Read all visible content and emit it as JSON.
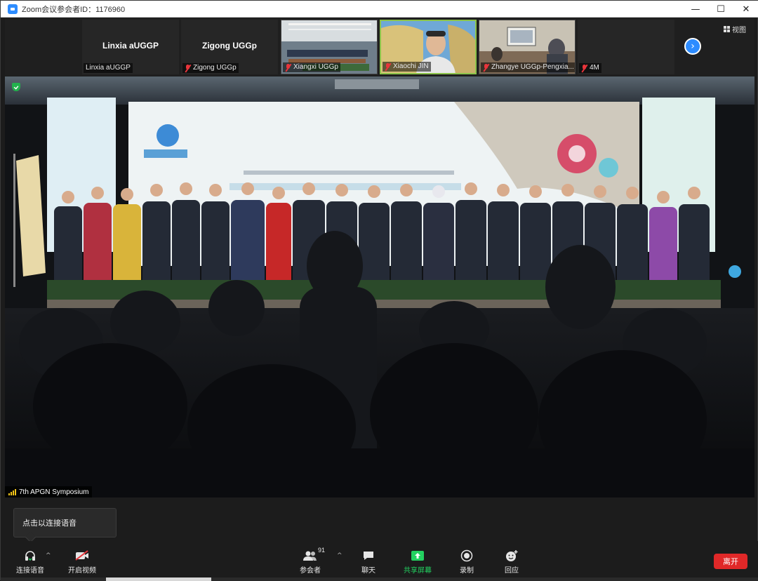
{
  "window": {
    "title": "Zoom会议参会者ID：1176960",
    "controls": [
      "—",
      "☐",
      "✕"
    ]
  },
  "strip": {
    "view_label": "视图",
    "participants": [
      {
        "big_name": "Linxia aUGGP",
        "label": "Linxia aUGGP",
        "muted": false,
        "video": false
      },
      {
        "big_name": "Zigong UGGp",
        "label": "Zigong UGGp",
        "muted": true,
        "video": false
      },
      {
        "big_name": "",
        "label": "Xiangxi UGGp",
        "muted": true,
        "video": true
      },
      {
        "big_name": "",
        "label": "Xiaochi JIN",
        "muted": true,
        "video": true,
        "active": true
      },
      {
        "big_name": "",
        "label": "Zhangye UGGp-Pengxia...",
        "muted": true,
        "video": true
      },
      {
        "big_name": "",
        "label": "4M",
        "muted": true,
        "video": false
      }
    ],
    "next_icon": "chevron-right-icon"
  },
  "main": {
    "speaker_label": "7th APGN Symposium",
    "encryption_icon": "shield-check-icon"
  },
  "tooltip": {
    "text": "点击以连接语音"
  },
  "toolbar": {
    "join_audio": "连接语音",
    "start_video": "开启视频",
    "participants": "参会者",
    "participants_count": "91",
    "chat": "聊天",
    "share_screen": "共享屏幕",
    "record": "录制",
    "reactions": "回应",
    "leave": "离开"
  },
  "colors": {
    "accent_blue": "#2d8cff",
    "share_green": "#23d160",
    "leave_red": "#e02828",
    "muted_red": "#e8353b"
  }
}
